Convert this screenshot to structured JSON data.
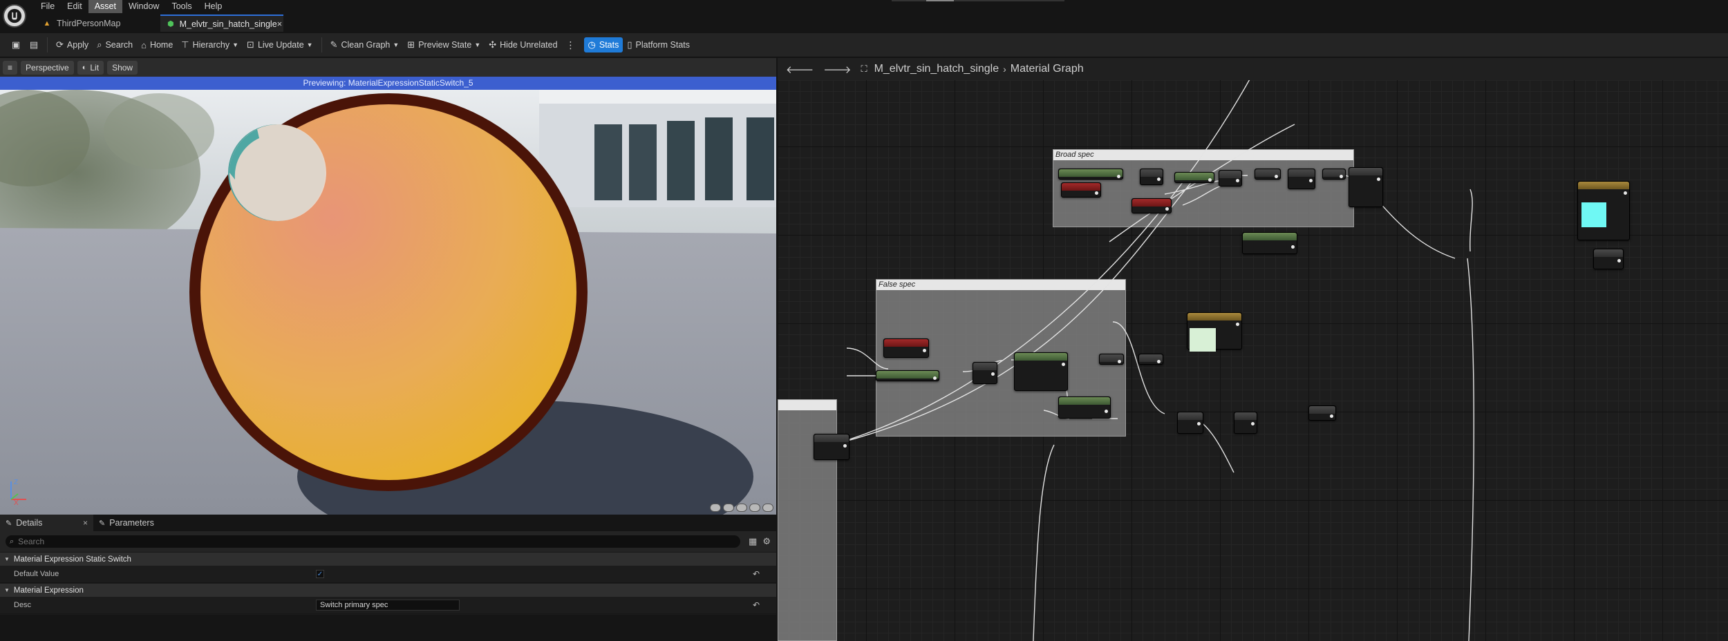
{
  "menu": {
    "items": [
      "File",
      "Edit",
      "Asset",
      "Window",
      "Tools",
      "Help"
    ],
    "active": "Asset"
  },
  "tabs": [
    {
      "label": "ThirdPersonMap",
      "icon": "map-icon"
    },
    {
      "label": "M_elvtr_sin_hatch_single",
      "icon": "material-icon",
      "active": true
    }
  ],
  "toolbar": {
    "apply": "Apply",
    "search": "Search",
    "home": "Home",
    "hierarchy": "Hierarchy",
    "live_update": "Live Update",
    "clean_graph": "Clean Graph",
    "preview_state": "Preview State",
    "hide_unrelated": "Hide Unrelated",
    "stats": "Stats",
    "platform_stats": "Platform Stats"
  },
  "viewport": {
    "perspective": "Perspective",
    "lit": "Lit",
    "show": "Show",
    "banner": "Previewing: MaterialExpressionStaticSwitch_5",
    "axis_z": "Z",
    "axis_x": "X"
  },
  "details": {
    "tab_details": "Details",
    "tab_parameters": "Parameters",
    "search_placeholder": "Search",
    "section_static_switch": "Material Expression Static Switch",
    "default_value_label": "Default Value",
    "default_value_checked": true,
    "section_expression": "Material Expression",
    "desc_label": "Desc",
    "desc_value": "Switch primary spec"
  },
  "graph": {
    "breadcrumb_asset": "M_elvtr_sin_hatch_single",
    "breadcrumb_graph": "Material Graph",
    "comment_broad": "Broad spec",
    "comment_false": "False spec"
  },
  "colors": {
    "accent": "#1f7bd8",
    "banner": "#3c5fcf",
    "sphere_orange": "#e8a060",
    "sphere_rim": "#4a1408",
    "cyan_swatch": "#6ff8f4",
    "pale_swatch": "#d8f0d6"
  }
}
